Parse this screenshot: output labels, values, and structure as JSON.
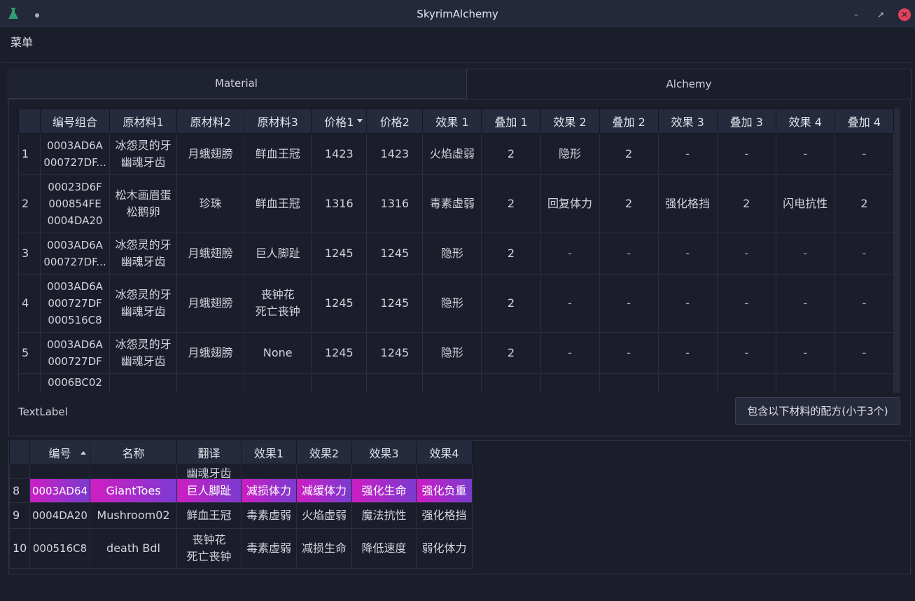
{
  "window": {
    "title": "SkyrimAlchemy"
  },
  "menu": {
    "label": "菜单"
  },
  "tabs": [
    {
      "label": "Material"
    },
    {
      "label": "Alchemy"
    }
  ],
  "recipe_table": {
    "headers": [
      "编号组合",
      "原材料1",
      "原材料2",
      "原材料3",
      "价格1",
      "价格2",
      "效果 1",
      "叠加 1",
      "效果 2",
      "叠加 2",
      "效果 3",
      "叠加 3",
      "效果 4",
      "叠加 4"
    ],
    "sort_column": "价格1",
    "rows": [
      {
        "num": "1",
        "ids": [
          "0003AD6A",
          "000727DF..."
        ],
        "m1": [
          "冰怨灵的牙",
          "幽魂牙齿"
        ],
        "m2": [
          "月蛾翅膀"
        ],
        "m3": [
          "鲜血王冠"
        ],
        "p1": "1423",
        "p2": "1423",
        "e1": "火焰虚弱",
        "s1": "2",
        "e2": "隐形",
        "s2": "2",
        "e3": "-",
        "s3": "-",
        "e4": "-",
        "s4": "-"
      },
      {
        "num": "2",
        "ids": [
          "00023D6F",
          "000854FE",
          "0004DA20"
        ],
        "m1": [
          "松木画眉蛋",
          "松鹅卵"
        ],
        "m2": [
          "珍珠"
        ],
        "m3": [
          "鲜血王冠"
        ],
        "p1": "1316",
        "p2": "1316",
        "e1": "毒素虚弱",
        "s1": "2",
        "e2": "回复体力",
        "s2": "2",
        "e3": "强化格挡",
        "s3": "2",
        "e4": "闪电抗性",
        "s4": "2"
      },
      {
        "num": "3",
        "ids": [
          "0003AD6A",
          "000727DF..."
        ],
        "m1": [
          "冰怨灵的牙",
          "幽魂牙齿"
        ],
        "m2": [
          "月蛾翅膀"
        ],
        "m3": [
          "巨人脚趾"
        ],
        "p1": "1245",
        "p2": "1245",
        "e1": "隐形",
        "s1": "2",
        "e2": "-",
        "s2": "-",
        "e3": "-",
        "s3": "-",
        "e4": "-",
        "s4": "-"
      },
      {
        "num": "4",
        "ids": [
          "0003AD6A",
          "000727DF",
          "000516C8"
        ],
        "m1": [
          "冰怨灵的牙",
          "幽魂牙齿"
        ],
        "m2": [
          "月蛾翅膀"
        ],
        "m3": [
          "丧钟花",
          "死亡丧钟"
        ],
        "p1": "1245",
        "p2": "1245",
        "e1": "隐形",
        "s1": "2",
        "e2": "-",
        "s2": "-",
        "e3": "-",
        "s3": "-",
        "e4": "-",
        "s4": "-"
      },
      {
        "num": "5",
        "ids": [
          "0003AD6A",
          "000727DF"
        ],
        "m1": [
          "冰怨灵的牙",
          "幽魂牙齿"
        ],
        "m2": [
          "月蛾翅膀"
        ],
        "m3": [
          "None"
        ],
        "p1": "1245",
        "p2": "1245",
        "e1": "隐形",
        "s1": "2",
        "e2": "-",
        "s2": "-",
        "e3": "-",
        "s3": "-",
        "e4": "-",
        "s4": "-"
      }
    ],
    "partial_row_id": "0006BC02"
  },
  "text_label": "TextLabel",
  "recipe_button": "包含以下材料的配方(小于3个)",
  "ingredient_table": {
    "headers": [
      "编号",
      "名称",
      "翻译",
      "效果1",
      "效果2",
      "效果3",
      "效果4"
    ],
    "sort_column": "编号",
    "partial_text": "幽魂牙齿",
    "rows": [
      {
        "num": "8",
        "id": "0003AD64",
        "name": "GiantToes",
        "trans": [
          "巨人脚趾"
        ],
        "e1": "减损体力",
        "e2": "减缓体力",
        "e3": "强化生命",
        "e4": "强化负重",
        "selected": true
      },
      {
        "num": "9",
        "id": "0004DA20",
        "name": "Mushroom02",
        "trans": [
          "鲜血王冠"
        ],
        "e1": "毒素虚弱",
        "e2": "火焰虚弱",
        "e3": "魔法抗性",
        "e4": "强化格挡",
        "selected": false
      },
      {
        "num": "10",
        "id": "000516C8",
        "name": "death Bdl",
        "trans": [
          "丧钟花",
          "死亡丧钟"
        ],
        "e1": "毒素虚弱",
        "e2": "减损生命",
        "e3": "降低速度",
        "e4": "弱化体力",
        "selected": false
      }
    ]
  },
  "colors": {
    "background": "#1b1d2a",
    "header": "#252a3c",
    "selection_start": "#cc1dc3",
    "selection_end": "#7a3bcf",
    "close_button": "#e0435a"
  }
}
